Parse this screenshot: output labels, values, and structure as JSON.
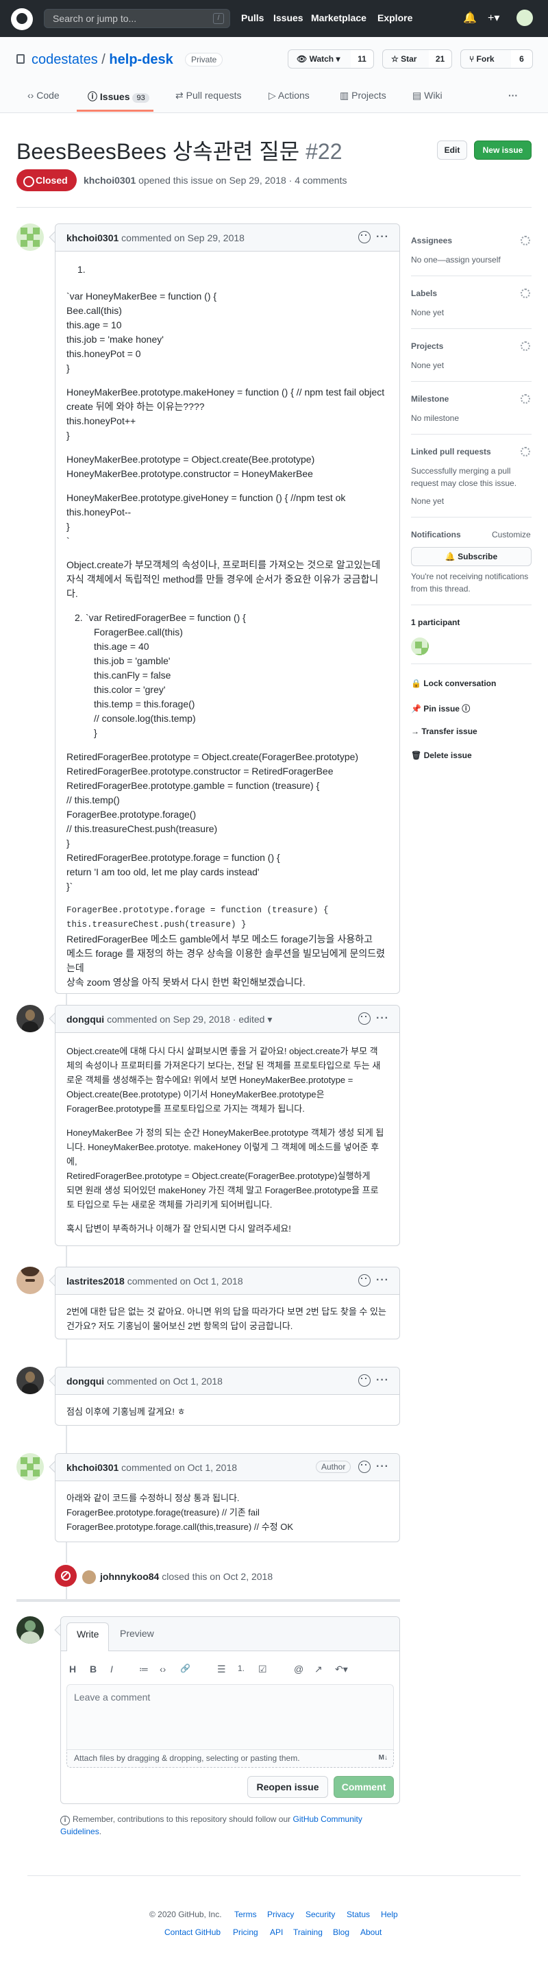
{
  "topbar": {
    "search_placeholder": "Search or jump to...",
    "search_key": "/",
    "nav": [
      "Pulls",
      "Issues",
      "Marketplace",
      "Explore"
    ],
    "plus": "+▾"
  },
  "repo": {
    "owner": "codestates",
    "separator": "/",
    "name": "help-desk",
    "visibility": "Private",
    "watch_label": "Watch ▾",
    "watch_count": "11",
    "star_label": "Star",
    "star_count": "21",
    "fork_label": "Fork",
    "fork_count": "6"
  },
  "tabs": [
    {
      "label": "Code"
    },
    {
      "label": "Issues",
      "count": "93"
    },
    {
      "label": "Pull requests"
    },
    {
      "label": "Actions"
    },
    {
      "label": "Projects"
    },
    {
      "label": "Wiki"
    }
  ],
  "issue": {
    "title": "BeesBeesBees 상속관련 질문",
    "number": "#22",
    "edit": "Edit",
    "new_issue": "New issue",
    "state": "Closed",
    "author": "khchoi0301",
    "meta": " opened this issue on Sep 29, 2018 · 4 comments"
  },
  "comments": [
    {
      "author": "khchoi0301",
      "action": " commented on Sep 29, 2018",
      "lines": [
        "1.",
        "`var HoneyMakerBee = function () {",
        "Bee.call(this)",
        "this.age = 10",
        "this.job = 'make honey'",
        "this.honeyPot = 0",
        "}",
        "HoneyMakerBee.prototype.makeHoney = function () { // npm test fail object",
        "create 뒤에 와야 하는 이유는????",
        "this.honeyPot++",
        "}",
        "HoneyMakerBee.prototype = Object.create(Bee.prototype)",
        "HoneyMakerBee.prototype.constructor = HoneyMakerBee",
        "HoneyMakerBee.prototype.giveHoney = function () { //npm test ok",
        "this.honeyPot--",
        "}",
        "`",
        "Object.create가 부모객체의 속성이나, 프로퍼티를 가져오는 것으로 알고있는데",
        "자식 객체에서 독립적인 method를 만들 경우에 순서가 중요한 이유가 궁금합니다.",
        "2.",
        "`var RetiredForagerBee = function () {",
        "ForagerBee.call(this)",
        "this.age = 40",
        "this.job = 'gamble'",
        "this.canFly = false",
        "this.color = 'grey'",
        "this.temp = this.forage()",
        "// console.log(this.temp)",
        "}",
        "RetiredForagerBee.prototype = Object.create(ForagerBee.prototype)",
        "RetiredForagerBee.prototype.constructor = RetiredForagerBee",
        "RetiredForagerBee.prototype.gamble = function (treasure) {",
        "// this.temp()",
        "ForagerBee.prototype.forage()",
        "// this.treasureChest.push(treasure)",
        "}",
        "RetiredForagerBee.prototype.forage = function () {",
        "return 'I am too old, let me play cards instead'",
        "}`",
        "ForagerBee.prototype.forage = function (treasure) {",
        "this.treasureChest.push(treasure) }",
        "RetiredForagerBee 메소드 gamble에서 부모 메소드 forage기능을 사용하고",
        "메소드 forage 를 재정의 하는 경우 상속을 이용한 솔루션을 빌모님에게 문의드렸는데",
        "상속 zoom 영상을 아직 못봐서 다시 한번 확인해보겠습니다."
      ]
    },
    {
      "author": "dongqui",
      "action": " commented on Sep 29, 2018 · edited ▾",
      "lines": [
        "Object.create에 대해 다시 다시 살펴보시면 좋을 거 같아요! object.create가 부모 객",
        "체의 속성이나 프로퍼티를 가져온다기 보다는, 전달 된 객체를 프로토타입으로 두는 새",
        "로운 객체를 생성해주는 함수에요! 위에서 보면 HoneyMakerBee.prototype =",
        "Object.create(Bee.prototype) 이기서 HoneyMakerBee.prototype은",
        "ForagerBee.prototype를 프로토타입으로 가지는 객체가 됩니다.",
        "HoneyMakerBee 가 정의 되는 순간 HoneyMakerBee.prototype 객체가 생성 되게 됩",
        "니다. HoneyMakerBee.prototye. makeHoney 이렇게 그 객체에 메소드를 넣어준 후에,",
        "RetiredForagerBee.prototype = Object.create(ForagerBee.prototype)실행하게",
        "되면 원래 생성 되어있던 makeHoney 가진 객체 말고 ForagerBee.prototype을 프로",
        "토 타입으로 두는 새로운 객체를 가리키게 되어버립니다.",
        "혹시 답변이 부족하거나 이해가 잘 안되시면 다시 알려주세요!"
      ]
    },
    {
      "author": "lastrites2018",
      "action": " commented on Oct 1, 2018",
      "lines": [
        "2번에 대한 답은 없는 것 같아요. 아니면 위의 답을 따라가다 보면 2번 답도 찾을 수 있는",
        "건가요? 저도 기홍님이 물어보신 2번 항목의 답이 궁금합니다."
      ]
    },
    {
      "author": "dongqui",
      "action": " commented on Oct 1, 2018",
      "lines": [
        "점심 이후에 기홍님께 갈게요! ㅎ"
      ]
    },
    {
      "author": "khchoi0301",
      "action": " commented on Oct 1, 2018",
      "badge": "Author",
      "lines": [
        "아래와 같이 코드를 수정하니 정상 통과 됩니다.",
        "ForagerBee.prototype.forage(treasure) // 기존 fail",
        "ForagerBee.prototype.forage.call(this,treasure) // 수정 OK"
      ]
    }
  ],
  "closed_event": {
    "actor": "johnnykoo84",
    "text": " closed this on Oct 2, 2018"
  },
  "editor": {
    "tab_write": "Write",
    "tab_preview": "Preview",
    "toolbar": [
      "H",
      "B",
      "I",
      "≔",
      "‹›",
      "🔗",
      "☰",
      "1.",
      "☑",
      "@",
      "↗",
      "↶▾"
    ],
    "placeholder": "Leave a comment",
    "attach": "Attach files by dragging & dropping, selecting or pasting them.",
    "md": "M↓",
    "reopen": "Reopen issue",
    "comment": "Comment",
    "note_pre": "Remember, contributions to this repository should follow our ",
    "note_link1": "GitHub Community",
    "note_link2": "Guidelines",
    "note_post": "."
  },
  "sidebar": {
    "assignees_h": "Assignees",
    "assignees_t": "No one—assign yourself",
    "labels_h": "Labels",
    "labels_t": "None yet",
    "projects_h": "Projects",
    "projects_t": "None yet",
    "milestone_h": "Milestone",
    "milestone_t": "No milestone",
    "linked_h": "Linked pull requests",
    "linked_t1": "Successfully merging a pull",
    "linked_t2": "request may close this issue.",
    "linked_t3": "None yet",
    "notif_h": "Notifications",
    "customize": "Customize",
    "subscribe": "Subscribe",
    "notif_t1": "You're not receiving notifications",
    "notif_t2": "from this thread.",
    "participants": "1 participant",
    "lock": "Lock conversation",
    "pin": "Pin issue",
    "transfer": "Transfer issue",
    "delete": "Delete issue"
  },
  "footer": {
    "copyright": "© 2020 GitHub, Inc.",
    "row1": [
      "Terms",
      "Privacy",
      "Security",
      "Status",
      "Help"
    ],
    "row2": [
      "Contact GitHub",
      "Pricing",
      "API",
      "Training",
      "Blog",
      "About"
    ]
  }
}
